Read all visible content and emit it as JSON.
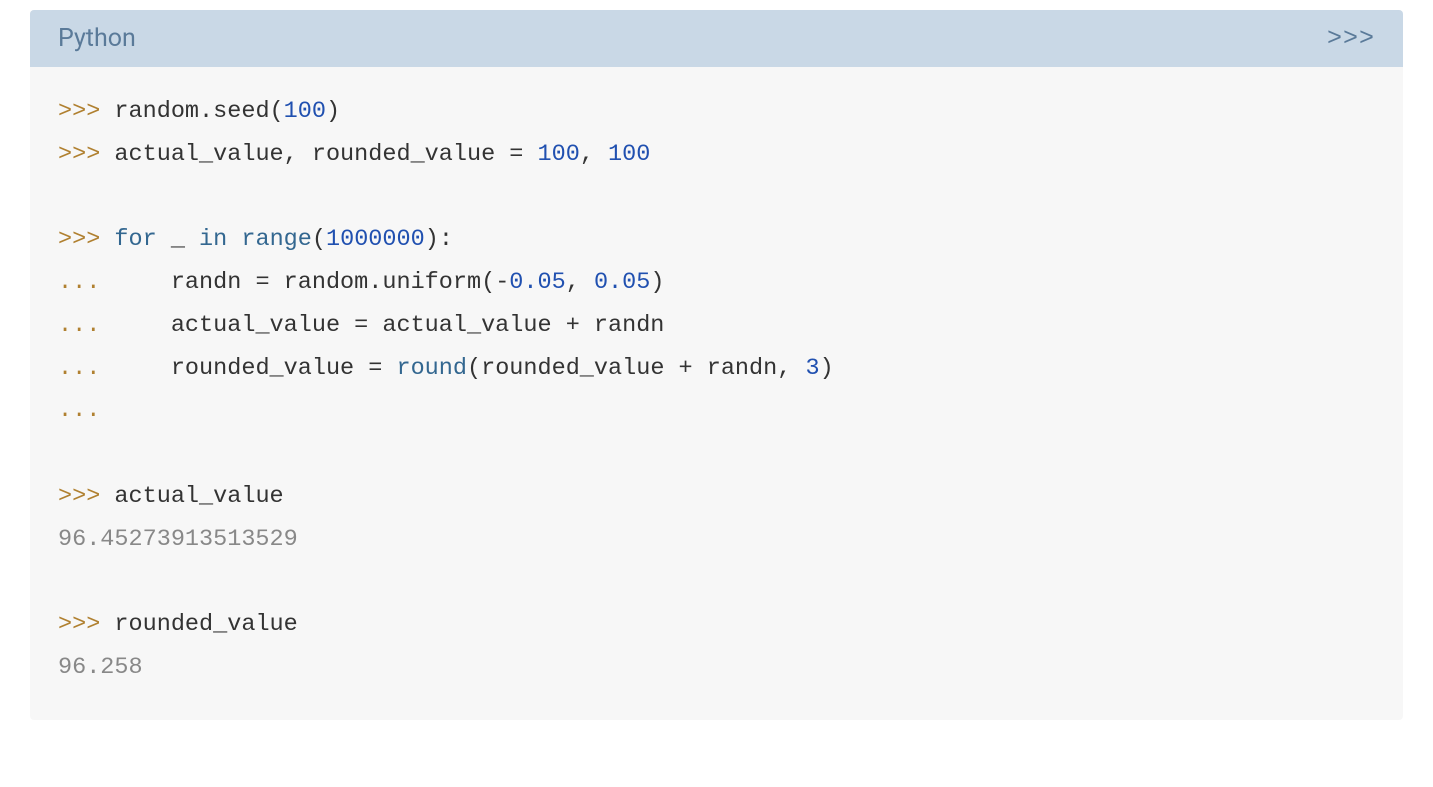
{
  "header": {
    "title": "Python",
    "toggle": ">>>"
  },
  "code": {
    "lines": [
      {
        "tokens": [
          {
            "t": ">>> ",
            "c": "prompt"
          },
          {
            "t": "random.seed(",
            "c": "plain"
          },
          {
            "t": "100",
            "c": "number"
          },
          {
            "t": ")",
            "c": "plain"
          }
        ]
      },
      {
        "tokens": [
          {
            "t": ">>> ",
            "c": "prompt"
          },
          {
            "t": "actual_value, rounded_value = ",
            "c": "plain"
          },
          {
            "t": "100",
            "c": "number"
          },
          {
            "t": ", ",
            "c": "plain"
          },
          {
            "t": "100",
            "c": "number"
          }
        ]
      },
      {
        "tokens": []
      },
      {
        "tokens": [
          {
            "t": ">>> ",
            "c": "prompt"
          },
          {
            "t": "for",
            "c": "keyword"
          },
          {
            "t": " _ ",
            "c": "plain"
          },
          {
            "t": "in",
            "c": "keyword"
          },
          {
            "t": " ",
            "c": "plain"
          },
          {
            "t": "range",
            "c": "builtin"
          },
          {
            "t": "(",
            "c": "plain"
          },
          {
            "t": "1000000",
            "c": "number"
          },
          {
            "t": "):",
            "c": "plain"
          }
        ]
      },
      {
        "tokens": [
          {
            "t": "... ",
            "c": "prompt"
          },
          {
            "t": "    randn = random.uniform(",
            "c": "plain"
          },
          {
            "t": "-",
            "c": "plain"
          },
          {
            "t": "0.05",
            "c": "number"
          },
          {
            "t": ", ",
            "c": "plain"
          },
          {
            "t": "0.05",
            "c": "number"
          },
          {
            "t": ")",
            "c": "plain"
          }
        ]
      },
      {
        "tokens": [
          {
            "t": "... ",
            "c": "prompt"
          },
          {
            "t": "    actual_value = actual_value + randn",
            "c": "plain"
          }
        ]
      },
      {
        "tokens": [
          {
            "t": "... ",
            "c": "prompt"
          },
          {
            "t": "    rounded_value = ",
            "c": "plain"
          },
          {
            "t": "round",
            "c": "builtin"
          },
          {
            "t": "(rounded_value + randn, ",
            "c": "plain"
          },
          {
            "t": "3",
            "c": "number"
          },
          {
            "t": ")",
            "c": "plain"
          }
        ]
      },
      {
        "tokens": [
          {
            "t": "...",
            "c": "prompt"
          }
        ]
      },
      {
        "tokens": []
      },
      {
        "tokens": [
          {
            "t": ">>> ",
            "c": "prompt"
          },
          {
            "t": "actual_value",
            "c": "plain"
          }
        ]
      },
      {
        "tokens": [
          {
            "t": "96.45273913513529",
            "c": "output"
          }
        ]
      },
      {
        "tokens": []
      },
      {
        "tokens": [
          {
            "t": ">>> ",
            "c": "prompt"
          },
          {
            "t": "rounded_value",
            "c": "plain"
          }
        ]
      },
      {
        "tokens": [
          {
            "t": "96.258",
            "c": "output"
          }
        ]
      }
    ]
  }
}
